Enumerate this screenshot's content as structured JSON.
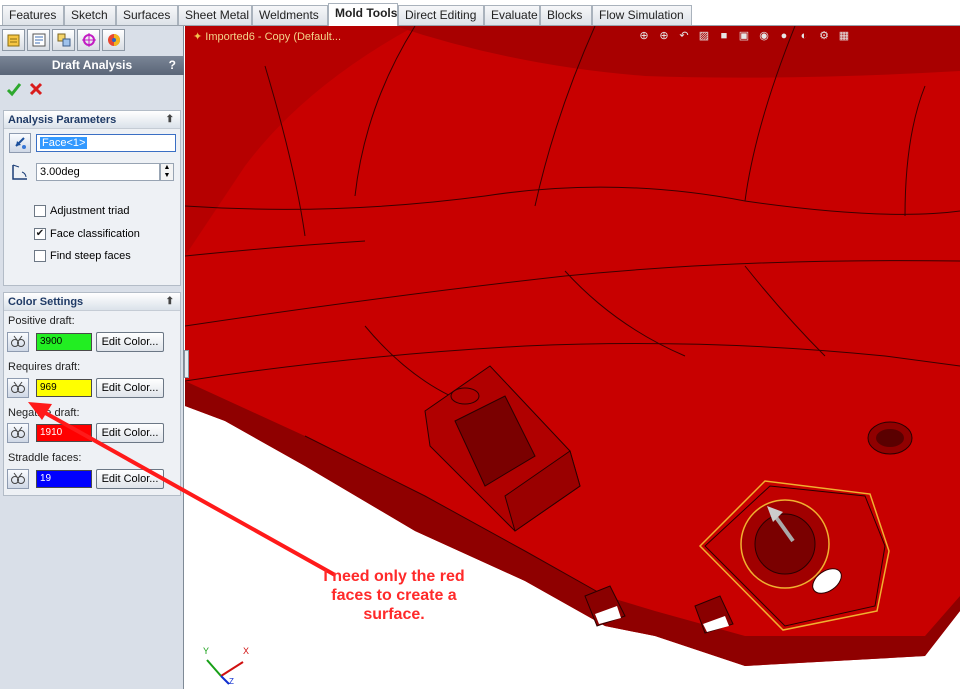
{
  "tabs": [
    "Features",
    "Sketch",
    "Surfaces",
    "Sheet Metal",
    "Weldments",
    "Mold Tools",
    "Direct Editing",
    "Evaluate",
    "Blocks",
    "Flow Simulation"
  ],
  "active_tab": "Mold Tools",
  "panel": {
    "title": "Draft Analysis",
    "help": "?",
    "analysis": {
      "header": "Analysis Parameters",
      "face": "Face<1>",
      "angle": "3.00deg",
      "options": [
        {
          "label": "Adjustment triad",
          "checked": false
        },
        {
          "label": "Face classification",
          "checked": true
        },
        {
          "label": "Find steep faces",
          "checked": false
        }
      ]
    },
    "color_settings": {
      "header": "Color Settings",
      "rows": [
        {
          "label": "Positive draft:",
          "count": "3900",
          "color": "#22ee22",
          "button": "Edit Color..."
        },
        {
          "label": "Requires draft:",
          "count": "969",
          "color": "#ffff00",
          "button": "Edit Color..."
        },
        {
          "label": "Negative draft:",
          "count": "1910",
          "color": "#ff0000",
          "button": "Edit Color..."
        },
        {
          "label": "Straddle faces:",
          "count": "19",
          "color": "#0000ff",
          "button": "Edit Color..."
        }
      ]
    }
  },
  "viewport": {
    "document_title": "Imported6 - Copy  (Default...",
    "model_color": "#cc0000",
    "annotation": "I need only the red faces to create a surface."
  },
  "triad": {
    "x": "X",
    "y": "Y",
    "z": "Z"
  }
}
